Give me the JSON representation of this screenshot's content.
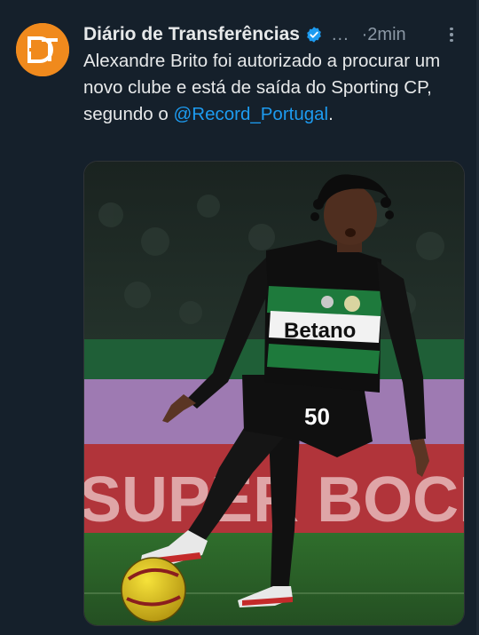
{
  "tweet": {
    "author_name": "Diário de Transferências",
    "ellipsis": "...",
    "time_separator": "·",
    "time": "2min",
    "text_before": "Alexandre Brito foi autorizado a procurar um novo clube e está de saída do Sporting CP, segundo o ",
    "mention": "@Record_Portugal",
    "text_after": "."
  },
  "avatar": {
    "logo_text": "DT",
    "background_color": "#f08a1d"
  },
  "media": {
    "jersey_sponsor": "Betano",
    "jersey_number": "50",
    "board_text": "SUPER BOCK",
    "pitch_color": "#2c6b2a",
    "kit_green": "#1e7a3c"
  },
  "icons": {
    "verified": "verified-badge-icon",
    "more": "more-options-icon"
  },
  "colors": {
    "background": "#15202b",
    "text": "#e7e9ea",
    "muted": "#8b98a5",
    "link": "#1d9bf0"
  }
}
